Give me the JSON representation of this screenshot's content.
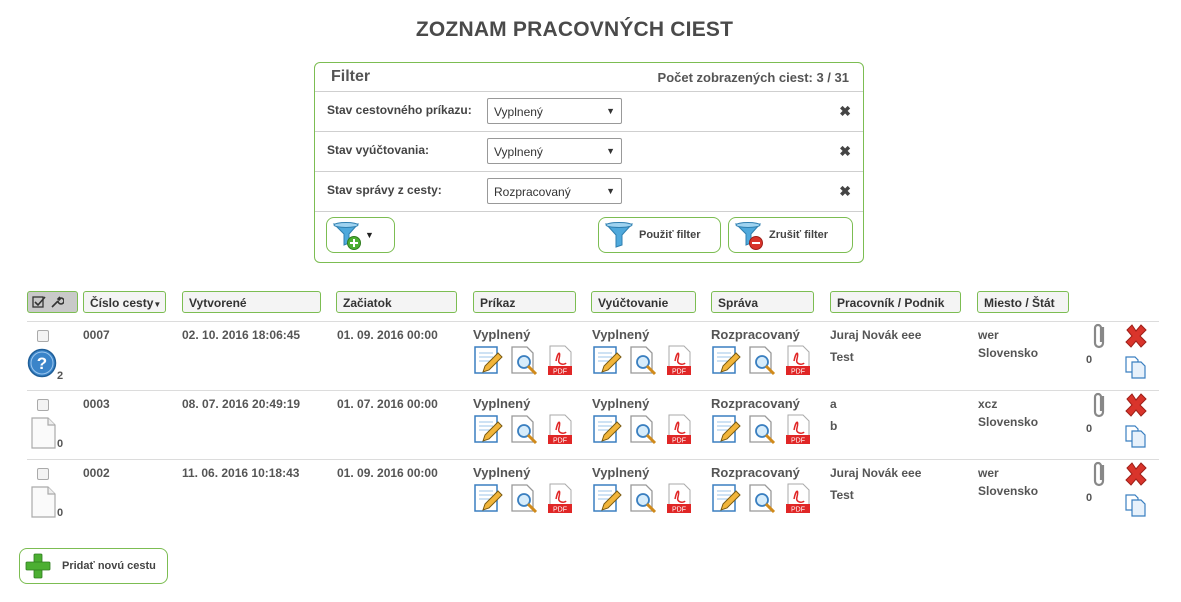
{
  "page": {
    "title": "ZOZNAM PRACOVNÝCH CIEST"
  },
  "filter": {
    "title": "Filter",
    "count_text": "Počet zobrazených ciest: 3 / 31",
    "rows": [
      {
        "label": "Stav cestovného príkazu:",
        "value": "Vyplnený"
      },
      {
        "label": "Stav vyúčtovania:",
        "value": "Vyplnený"
      },
      {
        "label": "Stav správy z cesty:",
        "value": "Rozpracovaný"
      }
    ],
    "apply_label": "Použiť filter",
    "cancel_label": "Zrušiť filter",
    "icons": {
      "remove": "close-x-icon",
      "add_filter": "funnel-add-icon",
      "apply": "funnel-icon",
      "cancel": "funnel-remove-icon"
    }
  },
  "table": {
    "headers": {
      "number": "Číslo cesty",
      "created": "Vytvorené",
      "start": "Začiatok",
      "order": "Príkaz",
      "billing": "Vyúčtovanie",
      "report": "Správa",
      "worker": "Pracovník / Podnik",
      "place": "Miesto / Štát"
    },
    "rows": [
      {
        "number": "0007",
        "created": "02. 10. 2016 18:06:45",
        "start": "01. 09. 2016 00:00",
        "order_status": "Vyplnený",
        "billing_status": "Vyplnený",
        "report_status": "Rozpracovaný",
        "worker_line1": "Juraj Novák eee",
        "worker_line2": "Test",
        "place_line1": "wer",
        "place_line2": "Slovensko",
        "doc_count": "2",
        "attachment_count": "0",
        "doc_icon": "help-icon"
      },
      {
        "number": "0003",
        "created": "08. 07. 2016 20:49:19",
        "start": "01. 07. 2016 00:00",
        "order_status": "Vyplnený",
        "billing_status": "Vyplnený",
        "report_status": "Rozpracovaný",
        "worker_line1": "a",
        "worker_line2": "b",
        "place_line1": "xcz",
        "place_line2": "Slovensko",
        "doc_count": "0",
        "attachment_count": "0",
        "doc_icon": "blank-document-icon"
      },
      {
        "number": "0002",
        "created": "11. 06. 2016 10:18:43",
        "start": "01. 09. 2016 00:00",
        "order_status": "Vyplnený",
        "billing_status": "Vyplnený",
        "report_status": "Rozpracovaný",
        "worker_line1": "Juraj Novák eee",
        "worker_line2": "Test",
        "place_line1": "wer",
        "place_line2": "Slovensko",
        "doc_count": "0",
        "attachment_count": "0",
        "doc_icon": "blank-document-icon"
      }
    ]
  },
  "add_trip": {
    "label": "Pridať novú cestu"
  },
  "colors": {
    "accent_border": "#7cbd52",
    "delete_red": "#d9342b",
    "pdf_red": "#e02626",
    "help_blue": "#3a84c9"
  }
}
